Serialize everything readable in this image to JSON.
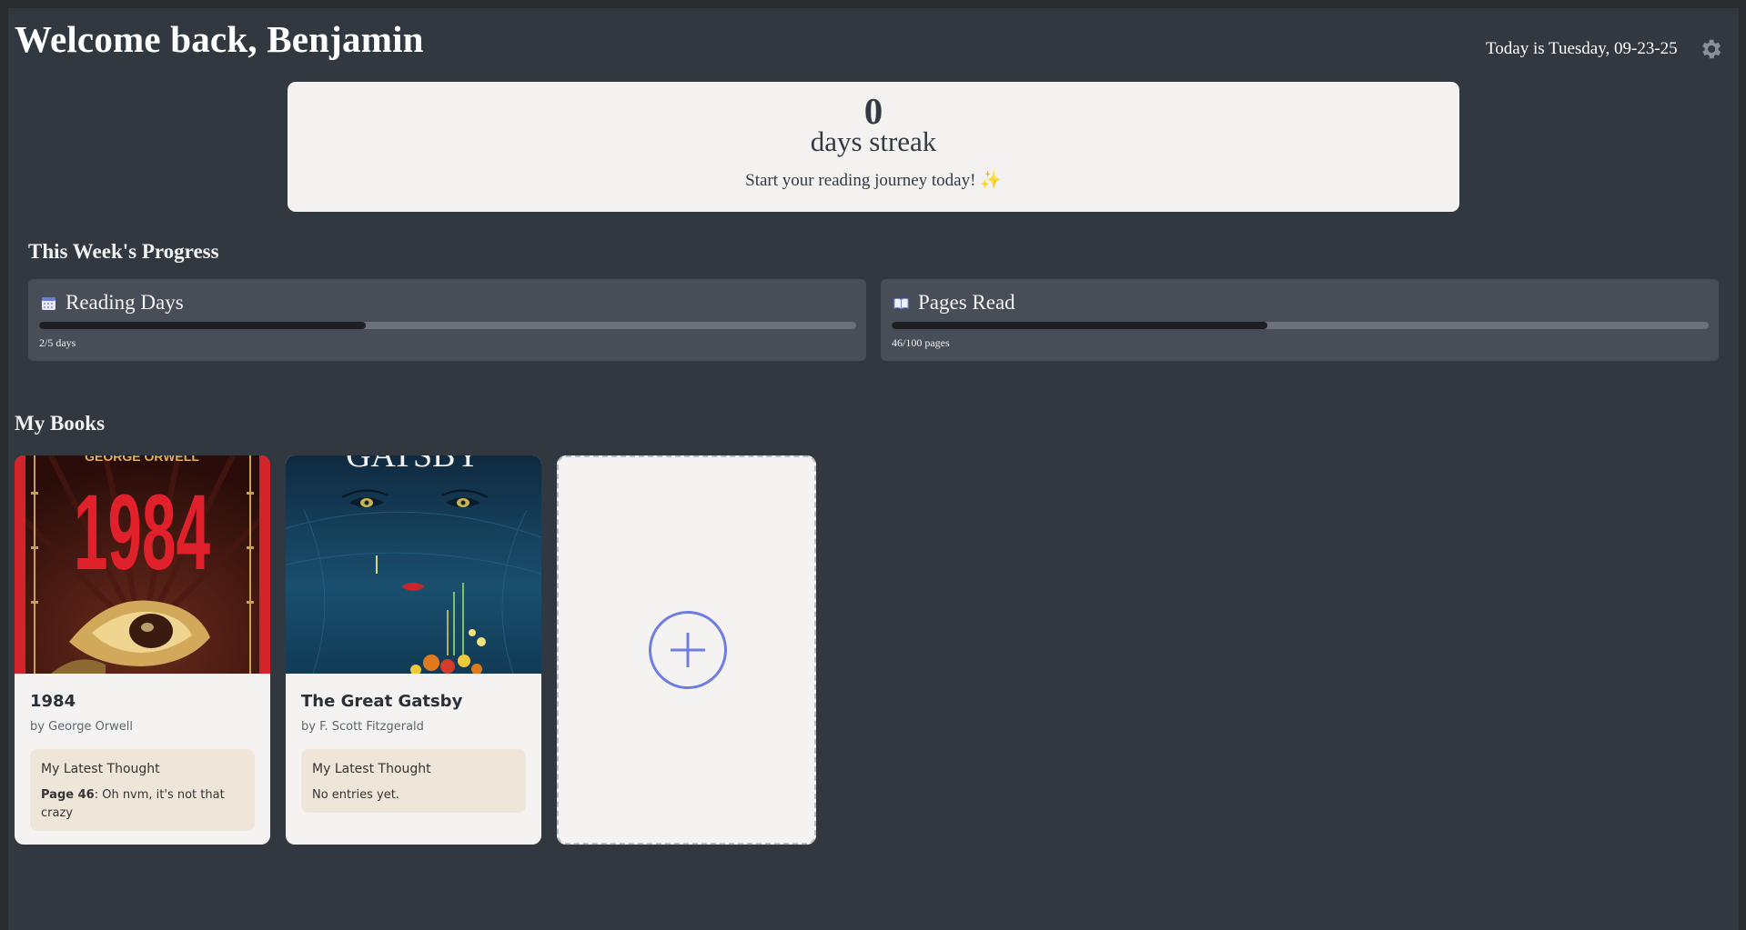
{
  "header": {
    "title": "Welcome back, Benjamin",
    "date_text": "Today is Tuesday, 09-23-25",
    "settings_icon": "gear-icon"
  },
  "streak": {
    "count": "0",
    "label": "days streak",
    "message": "Start your reading journey today! ✨"
  },
  "weekly_progress": {
    "title": "This Week's Progress",
    "cards": [
      {
        "label": "Reading Days",
        "icon": "calendar-icon",
        "progress_fraction": 0.4,
        "text": "2/5 days"
      },
      {
        "label": "Pages Read",
        "icon": "book-icon",
        "progress_fraction": 0.46,
        "text": "46/100 pages"
      }
    ]
  },
  "my_books": {
    "title": "My Books",
    "books": [
      {
        "title": "1984",
        "author": "by George Orwell",
        "thought_title": "My Latest Thought",
        "thought_page": "Page 46",
        "thought_text": ": Oh nvm, it's not that crazy",
        "cover_text_top": "GEORGE ORWELL",
        "cover_text_big": "1984"
      },
      {
        "title": "The Great Gatsby",
        "author": "by F. Scott Fitzgerald",
        "thought_title": "My Latest Thought",
        "thought_text": "No entries yet.",
        "cover_text_top": "GATSBY"
      }
    ],
    "add_icon": "plus-icon"
  },
  "colors": {
    "background": "#323840",
    "card": "#f4f2f0",
    "progress_card": "#474e57",
    "accent": "#6f7ce4"
  }
}
